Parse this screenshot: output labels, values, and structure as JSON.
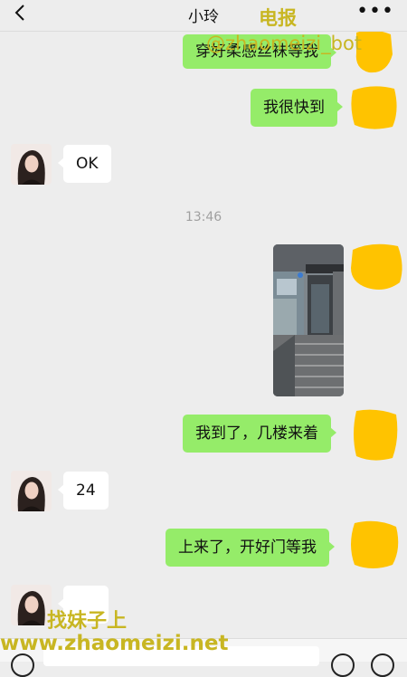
{
  "header": {
    "title": "小玲",
    "more_icon": "more-icon",
    "back_icon": "back-arrow-icon"
  },
  "messages": [
    {
      "side": "out",
      "text": "穿好柔感丝袜等我"
    },
    {
      "side": "out",
      "text": "我很快到"
    },
    {
      "side": "in",
      "text": "OK"
    },
    {
      "side": "out",
      "type": "image"
    },
    {
      "side": "out",
      "text": "我到了，几楼来着"
    },
    {
      "side": "in",
      "text": "24"
    },
    {
      "side": "out",
      "text": "上来了，开好门等我"
    },
    {
      "side": "in",
      "text": ""
    }
  ],
  "timestamp": "13:46",
  "watermarks": {
    "top_label": "电报",
    "top_handle": "@zhaomeizi_bot",
    "bottom_label": "找妹子上",
    "bottom_url": "www.zhaomeizi.net"
  },
  "colors": {
    "outgoing_bubble": "#95ec69",
    "incoming_bubble": "#ffffff",
    "background": "#ededed",
    "censor_blot": "#ffc300",
    "watermark": "#c8b622"
  }
}
